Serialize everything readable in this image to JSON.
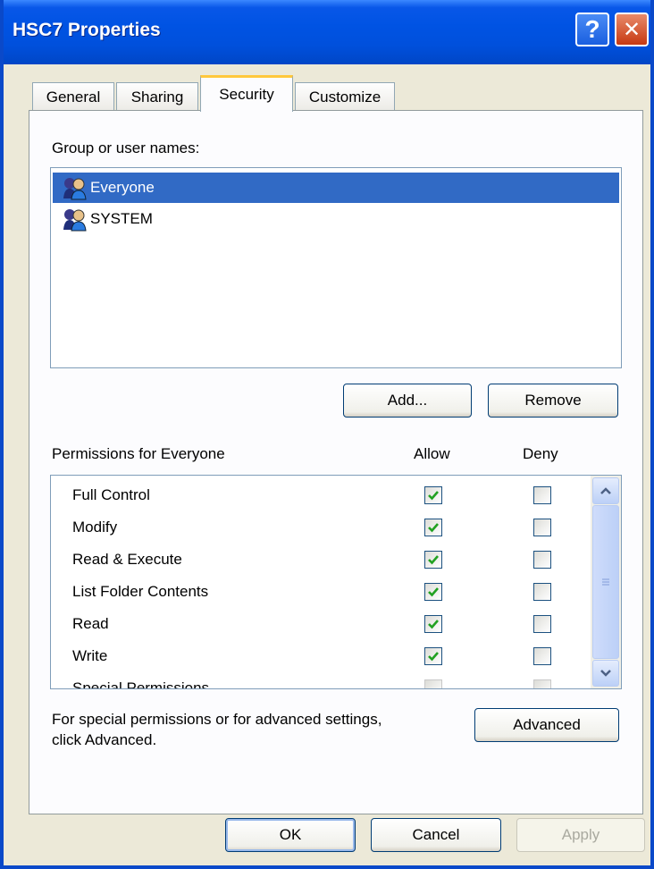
{
  "window": {
    "title": "HSC7 Properties",
    "help_label": "?",
    "close_label": "✕"
  },
  "tabs": [
    {
      "label": "General",
      "active": false
    },
    {
      "label": "Sharing",
      "active": false
    },
    {
      "label": "Security",
      "active": true
    },
    {
      "label": "Customize",
      "active": false
    }
  ],
  "security": {
    "group_label": "Group or user names:",
    "users": [
      {
        "name": "Everyone",
        "icon": "users-group-icon",
        "selected": true
      },
      {
        "name": "SYSTEM",
        "icon": "users-group-icon",
        "selected": false
      }
    ],
    "add_button": "Add...",
    "remove_button": "Remove",
    "permissions_label": "Permissions for Everyone",
    "allow_header": "Allow",
    "deny_header": "Deny",
    "permissions": [
      {
        "name": "Full Control",
        "allow": true,
        "deny": false
      },
      {
        "name": "Modify",
        "allow": true,
        "deny": false
      },
      {
        "name": "Read & Execute",
        "allow": true,
        "deny": false
      },
      {
        "name": "List Folder Contents",
        "allow": true,
        "deny": false
      },
      {
        "name": "Read",
        "allow": true,
        "deny": false
      },
      {
        "name": "Write",
        "allow": true,
        "deny": false
      },
      {
        "name": "Special Permissions",
        "allow": false,
        "deny": false
      }
    ],
    "advanced_text_line1": "For special permissions or for advanced settings,",
    "advanced_text_line2": "click Advanced.",
    "advanced_button": "Advanced"
  },
  "footer": {
    "ok_button": "OK",
    "cancel_button": "Cancel",
    "apply_button": "Apply",
    "apply_enabled": false
  },
  "colors": {
    "titlebar": "#0050dc",
    "selection": "#316ac5",
    "check": "#21a121",
    "dialog_bg": "#ece9d8"
  }
}
